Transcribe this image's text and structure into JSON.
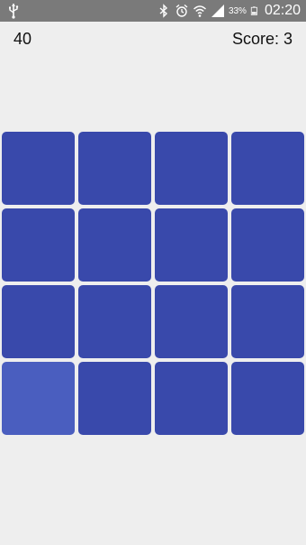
{
  "status_bar": {
    "battery_percent": "33%",
    "time": "02:20",
    "icons": [
      "usb-icon",
      "bluetooth-icon",
      "alarm-icon",
      "wifi-icon",
      "signal-icon",
      "battery-icon"
    ]
  },
  "game": {
    "timer": "40",
    "score_label": "Score: 3",
    "grid": {
      "rows": 4,
      "columns": 4,
      "highlighted_tile": {
        "row": 4,
        "column": 1
      }
    },
    "colors": {
      "background": "#eeeeee",
      "tile": "#3949ab",
      "tile_highlight": "#4a5ebf"
    }
  }
}
